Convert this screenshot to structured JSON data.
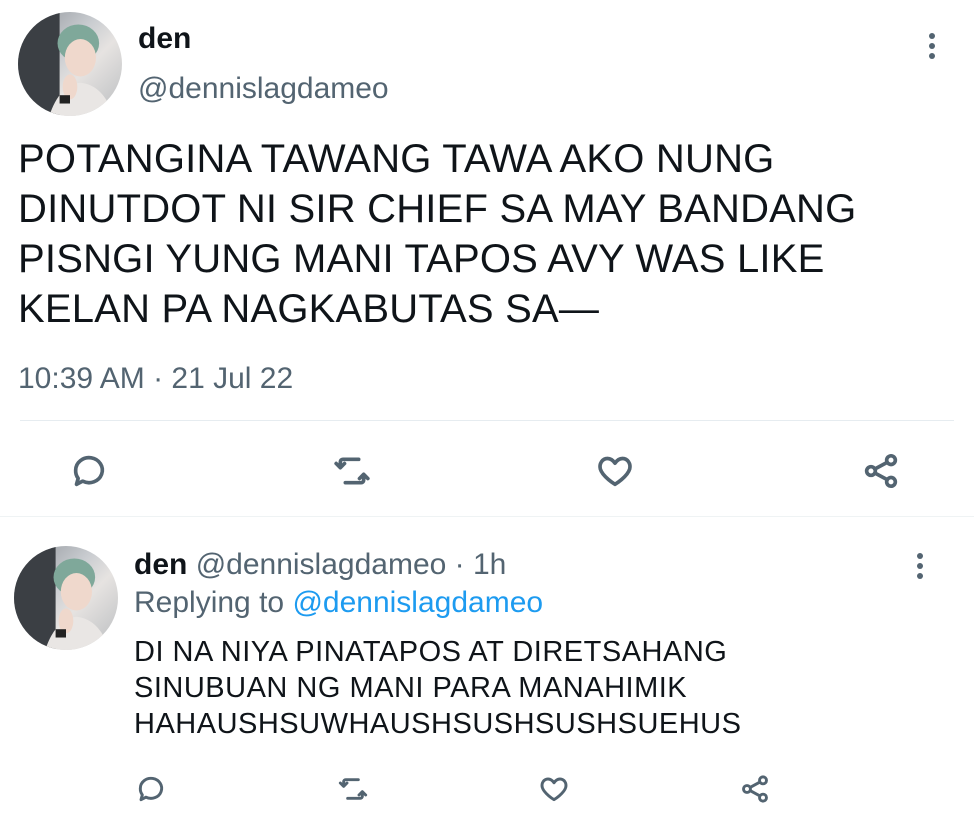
{
  "main_tweet": {
    "display_name": "den",
    "handle": "@dennislagdameo",
    "text": "POTANGINA TAWANG TAWA AKO NUNG\nDINUTDOT NI SIR CHIEF SA MAY BANDANG\nPISNGI YUNG MANI TAPOS AVY WAS LIKE\nKELAN PA NAGKABUTAS SA—",
    "timestamp": "10:39 AM · 21 Jul 22",
    "actions": [
      "reply-icon",
      "retweet-icon",
      "like-icon",
      "share-icon"
    ]
  },
  "reply_tweet": {
    "display_name": "den",
    "handle": "@dennislagdameo",
    "separator": "·",
    "age": "1h",
    "replying_prefix": "Replying to",
    "replying_to": "@dennislagdameo",
    "text": "DI NA NIYA PINATAPOS AT DIRETSAHANG\nSINUBUAN NG MANI PARA MANAHIMIK\nHAHAUSHSUWHAUSHSUSHSUSHSUEHUS",
    "actions": [
      "reply-icon",
      "retweet-icon",
      "like-icon",
      "share-icon"
    ]
  },
  "colors": {
    "text": "#0f1419",
    "secondary": "#536471",
    "link": "#1d9bf0",
    "divider": "#e6ecf0"
  }
}
